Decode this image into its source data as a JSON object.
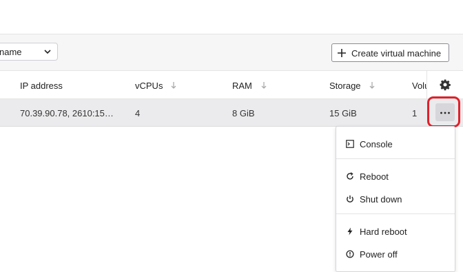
{
  "toolbar": {
    "sort_select_value": "name",
    "create_button_label": "Create virtual machine"
  },
  "table": {
    "headers": {
      "ip": "IP address",
      "vcpus": "vCPUs",
      "ram": "RAM",
      "storage": "Storage",
      "volumes": "Volu"
    },
    "rows": [
      {
        "ip": "70.39.90.78, 2610:15…",
        "vcpus": "4",
        "ram": "8 GiB",
        "storage": "15 GiB",
        "volumes": "1"
      }
    ]
  },
  "row_menu": {
    "items": [
      {
        "label": "Console",
        "icon": "terminal-icon"
      },
      {
        "label": "Reboot",
        "icon": "reboot-icon"
      },
      {
        "label": "Shut down",
        "icon": "power-icon"
      },
      {
        "label": "Hard reboot",
        "icon": "bolt-icon"
      },
      {
        "label": "Power off",
        "icon": "power-off-icon"
      }
    ]
  },
  "colors": {
    "highlight": "#e0202a",
    "row_selected": "#ebebed",
    "toolbar_bg": "#f6f6f7"
  }
}
